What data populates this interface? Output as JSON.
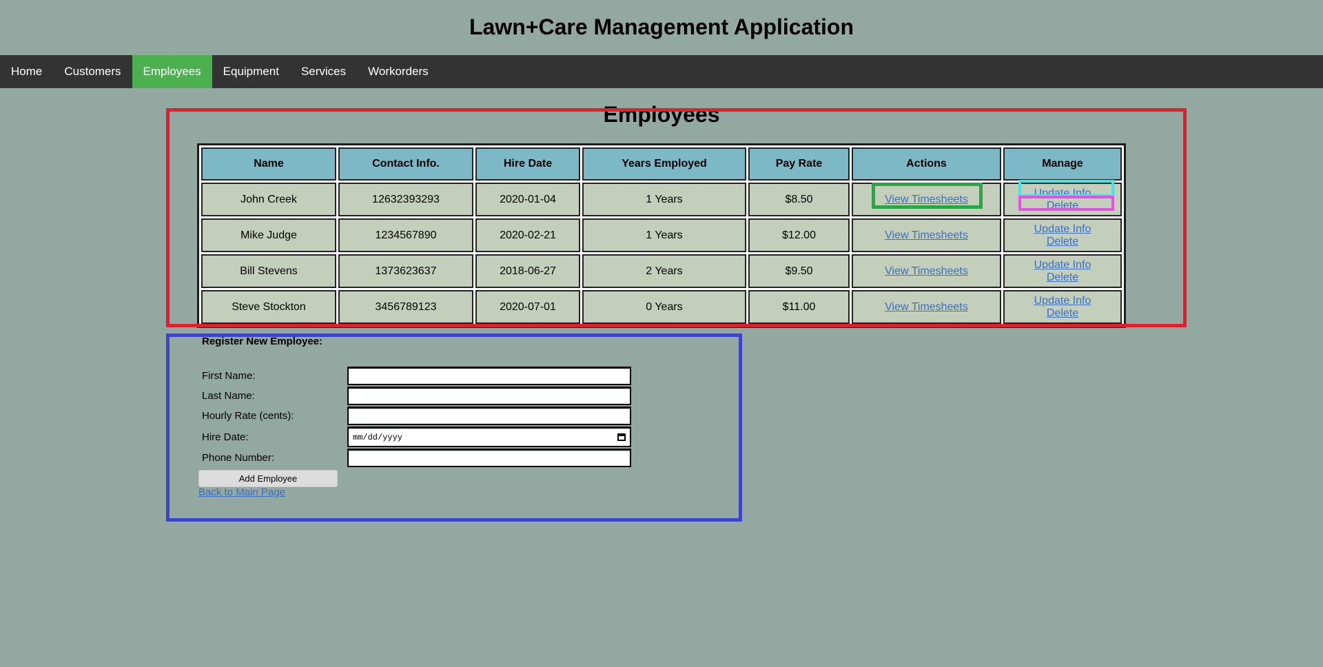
{
  "app": {
    "title": "Lawn+Care Management Application"
  },
  "nav": {
    "items": [
      {
        "label": "Home",
        "active": false
      },
      {
        "label": "Customers",
        "active": false
      },
      {
        "label": "Employees",
        "active": true
      },
      {
        "label": "Equipment",
        "active": false
      },
      {
        "label": "Services",
        "active": false
      },
      {
        "label": "Workorders",
        "active": false
      }
    ]
  },
  "page": {
    "heading": "Employees"
  },
  "table": {
    "headers": [
      "Name",
      "Contact Info.",
      "Hire Date",
      "Years Employed",
      "Pay Rate",
      "Actions",
      "Manage"
    ],
    "rows": [
      {
        "name": "John Creek",
        "contact": "12632393293",
        "hire_date": "2020-01-04",
        "years": "1 Years",
        "pay": "$8.50",
        "action": "View Timesheets",
        "update": "Update Info",
        "delete": "Delete"
      },
      {
        "name": "Mike Judge",
        "contact": "1234567890",
        "hire_date": "2020-02-21",
        "years": "1 Years",
        "pay": "$12.00",
        "action": "View Timesheets",
        "update": "Update Info",
        "delete": "Delete"
      },
      {
        "name": "Bill Stevens",
        "contact": "1373623637",
        "hire_date": "2018-06-27",
        "years": "2 Years",
        "pay": "$9.50",
        "action": "View Timesheets",
        "update": "Update Info",
        "delete": "Delete"
      },
      {
        "name": "Steve Stockton",
        "contact": "3456789123",
        "hire_date": "2020-07-01",
        "years": "0 Years",
        "pay": "$11.00",
        "action": "View Timesheets",
        "update": "Update Info",
        "delete": "Delete"
      }
    ]
  },
  "register": {
    "title": "Register New Employee:",
    "first_name_label": "First Name:",
    "last_name_label": "Last Name:",
    "hourly_rate_label": "Hourly Rate (cents):",
    "hire_date_label": "Hire Date:",
    "hire_date_placeholder": "mm/dd/yyyy",
    "phone_label": "Phone Number:",
    "submit_label": "Add Employee",
    "back_link": "Back to Main Page"
  },
  "colors": {
    "background": "#93a8a0",
    "nav": "#333333",
    "nav_active": "#4caf50",
    "header_cell": "#7db8c6",
    "body_cell": "#c3cebb",
    "link": "#3b6fc4",
    "highlight_red": "#e0202e",
    "highlight_blue": "#3d44c8",
    "highlight_green": "#27a844",
    "highlight_cyan": "#3ee8e4",
    "highlight_pink": "#e452e4"
  }
}
